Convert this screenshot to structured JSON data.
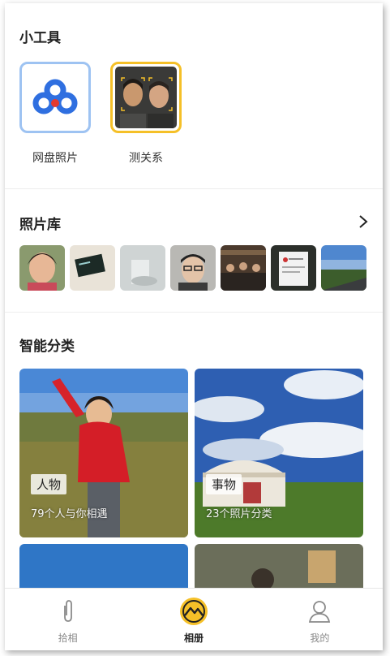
{
  "tools": {
    "title": "小工具",
    "items": [
      {
        "label": "网盘照片",
        "icon": "baidu-cloud-icon"
      },
      {
        "label": "测关系",
        "icon": "face-relation-icon"
      }
    ]
  },
  "library": {
    "title": "照片库",
    "more_icon": "chevron-right-icon"
  },
  "categories": {
    "title": "智能分类",
    "cards": [
      {
        "chip": "人物",
        "sub": "79个人与你相遇"
      },
      {
        "chip": "事物",
        "sub": "23个照片分类"
      }
    ]
  },
  "bottom_nav": {
    "items": [
      {
        "label": "拾相",
        "icon": "paperclip-icon",
        "active": false
      },
      {
        "label": "相册",
        "icon": "album-mountain-icon",
        "active": true
      },
      {
        "label": "我的",
        "icon": "user-icon",
        "active": false
      }
    ]
  },
  "colors": {
    "tool_border": "#9ec3f2",
    "tool_selected_border": "#f5c028",
    "active_accent": "#f5c028",
    "baidu_blue": "#2f6fe0",
    "baidu_red": "#e33a2f"
  }
}
